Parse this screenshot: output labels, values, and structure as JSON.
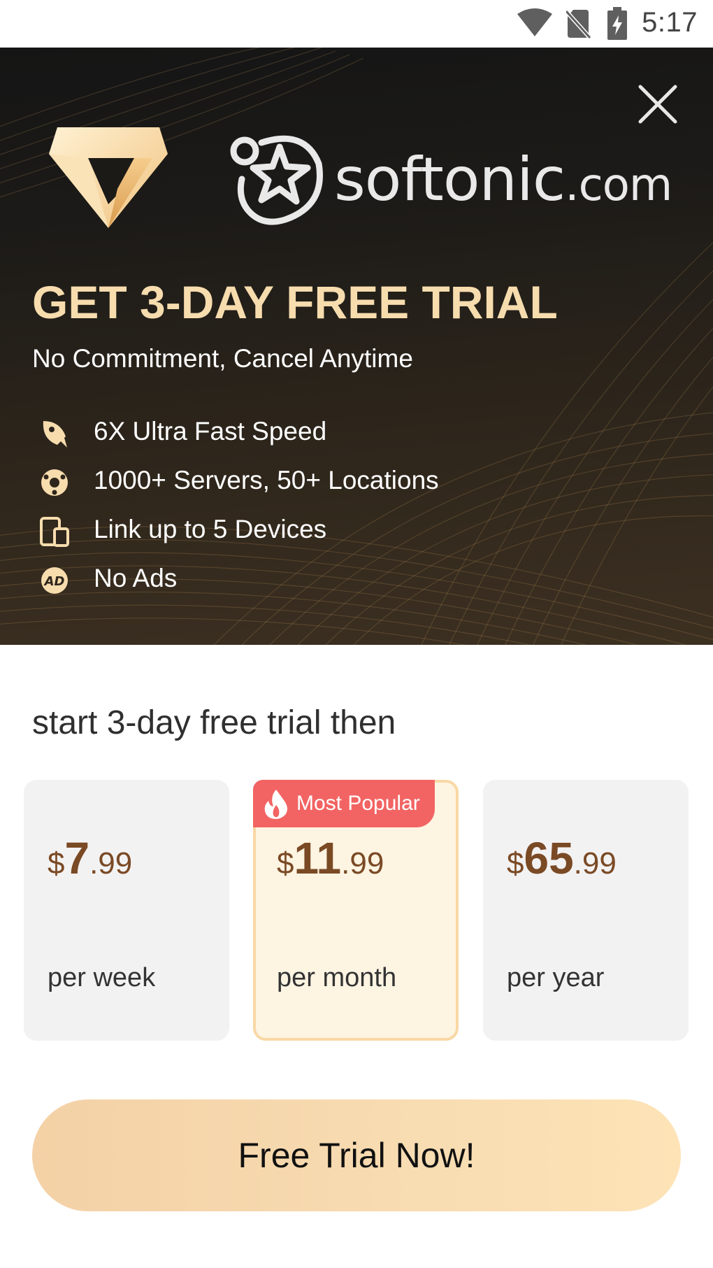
{
  "status_bar": {
    "time": "5:17",
    "icons": [
      "wifi-icon",
      "no-sim-icon",
      "battery-charging-icon"
    ]
  },
  "hero": {
    "brand_name": "softonic",
    "brand_domain": ".com",
    "title": "GET 3-DAY FREE TRIAL",
    "subtitle": "No Commitment, Cancel Anytime",
    "features": [
      {
        "icon": "rocket-icon",
        "label": "6X Ultra Fast Speed"
      },
      {
        "icon": "globe-icon",
        "label": "1000+ Servers, 50+ Locations"
      },
      {
        "icon": "devices-icon",
        "label": "Link up to 5 Devices"
      },
      {
        "icon": "no-ads-icon",
        "label": "No Ads"
      }
    ],
    "no_ads_icon_text": "AD",
    "accent_color": "#f7dcae"
  },
  "pricing": {
    "heading": "start 3-day free trial then",
    "plans": [
      {
        "currency": "$",
        "integer": "7",
        "decimal": ".99",
        "period": "per week",
        "selected": false
      },
      {
        "currency": "$",
        "integer": "11",
        "decimal": ".99",
        "period": "per month",
        "selected": true,
        "badge": "Most Popular"
      },
      {
        "currency": "$",
        "integer": "65",
        "decimal": ".99",
        "period": "per year",
        "selected": false
      }
    ],
    "badge_color": "#f26463",
    "price_color": "#7a4a25"
  },
  "cta": {
    "label": "Free Trial Now!"
  }
}
